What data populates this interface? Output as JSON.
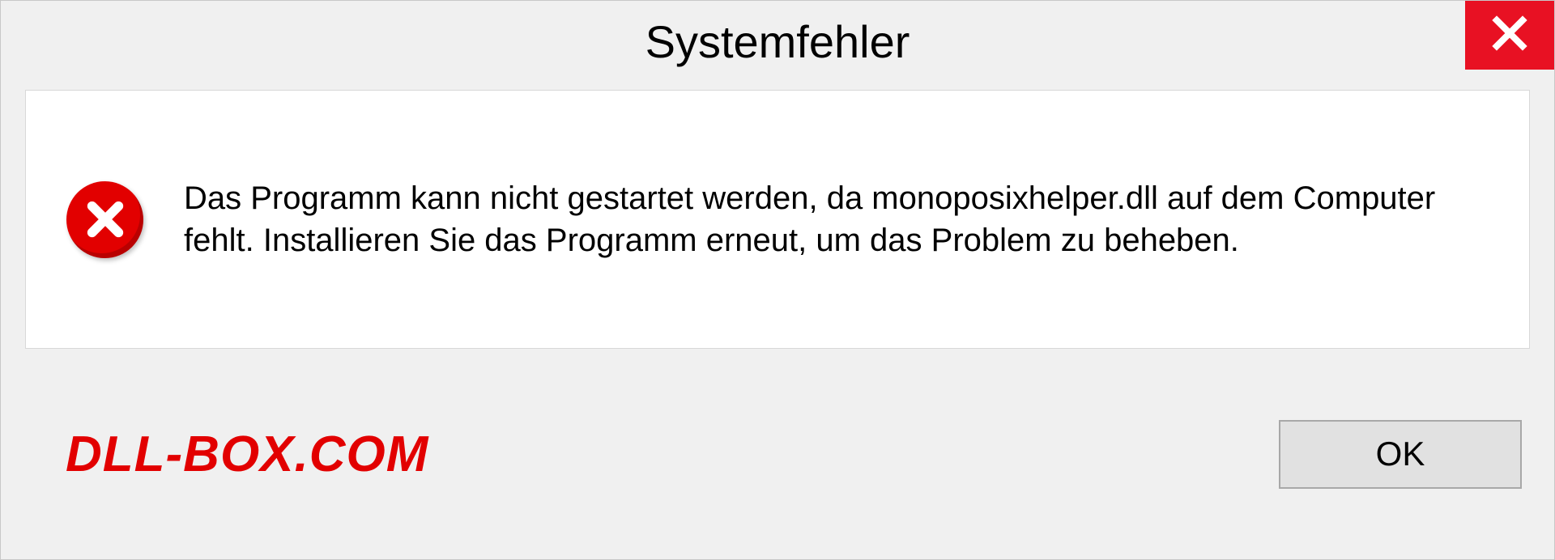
{
  "dialog": {
    "title": "Systemfehler",
    "message": "Das Programm kann nicht gestartet werden, da monoposixhelper.dll auf dem Computer fehlt. Installieren Sie das Programm erneut, um das Problem zu beheben.",
    "ok_label": "OK"
  },
  "watermark": "DLL-BOX.COM",
  "colors": {
    "close_bg": "#e81123",
    "error_red": "#e20000"
  }
}
